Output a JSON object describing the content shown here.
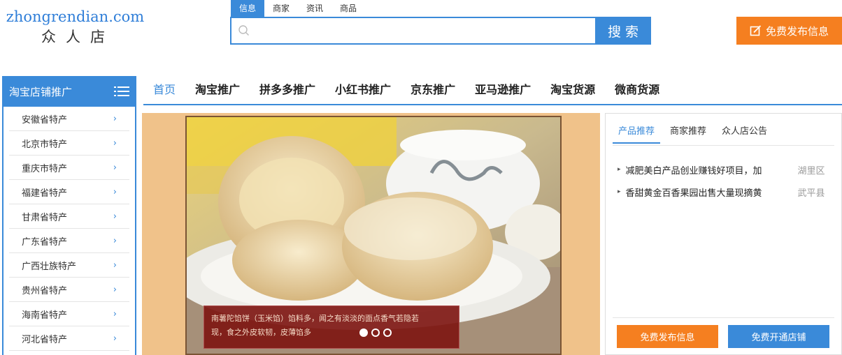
{
  "logo": {
    "domain": "zhongrendian.com",
    "name": "众人店"
  },
  "search": {
    "tabs": [
      "信息",
      "商家",
      "资讯",
      "商品"
    ],
    "active_tab": 0,
    "value": "",
    "placeholder": "",
    "button_label": "搜索"
  },
  "publish_button_label": "免费发布信息",
  "sidebar": {
    "title": "淘宝店铺推广",
    "items": [
      {
        "label": "安徽省特产"
      },
      {
        "label": "北京市特产"
      },
      {
        "label": "重庆市特产"
      },
      {
        "label": "福建省特产"
      },
      {
        "label": "甘肃省特产"
      },
      {
        "label": "广东省特产"
      },
      {
        "label": "广西壮族特产"
      },
      {
        "label": "贵州省特产"
      },
      {
        "label": "海南省特产"
      },
      {
        "label": "河北省特产"
      }
    ],
    "chevron": "›"
  },
  "nav": {
    "items": [
      "首页",
      "淘宝推广",
      "拼多多推广",
      "小红书推广",
      "京东推广",
      "亚马逊推广",
      "淘宝货源",
      "微商货源"
    ],
    "active": 0
  },
  "banner": {
    "caption_line1": "南薯陀馅饼（玉米馅）馅料多，闻之有淡淡的面点香气若隐若",
    "caption_line2": "现，食之外皮软韧，皮薄馅多",
    "slides": 3,
    "active_slide": 0
  },
  "panel": {
    "tabs": [
      "产品推荐",
      "商家推荐",
      "众人店公告"
    ],
    "active_tab": 0,
    "items": [
      {
        "title": "减肥美白产品创业赚钱好项目，加",
        "area": "湖里区"
      },
      {
        "title": "香甜黄金百香果园出售大量现摘黄",
        "area": "武平县"
      }
    ],
    "btn_publish": "免费发布信息",
    "btn_open_shop": "免费开通店铺"
  },
  "colors": {
    "accent": "#3a8ad9",
    "orange": "#f57f20"
  },
  "icons": {
    "search": "search-icon",
    "list": "list-icon",
    "edit": "edit-icon"
  }
}
